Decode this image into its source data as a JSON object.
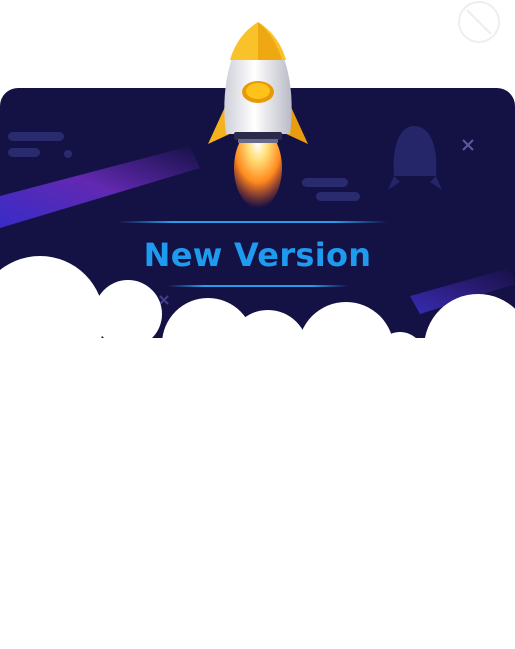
{
  "dialog": {
    "title": "New Version"
  },
  "icons": {
    "rocket": "rocket-icon",
    "close": "close-icon"
  },
  "colors": {
    "sky": "#141145",
    "title": "#1e9bef",
    "rocket_wing": "#f7b81c",
    "flame": "#ff9a1f"
  }
}
